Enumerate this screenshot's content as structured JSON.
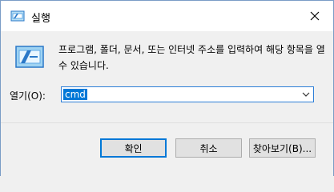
{
  "window": {
    "title": "실행",
    "description": "프로그램, 폴더, 문서, 또는 인터넷 주소를 입력하여 해당 항목을 열 수 있습니다.",
    "open_label": "열기(O):",
    "input_value": "cmd"
  },
  "buttons": {
    "ok": "확인",
    "cancel": "취소",
    "browse": "찾아보기(B)..."
  },
  "icons": {
    "title": "run-icon",
    "large": "run-large-icon",
    "close": "close-icon",
    "dropdown": "chevron-down-icon"
  },
  "colors": {
    "accent": "#0078d7",
    "selection_text": "#ffffff",
    "dialog_bg": "#f0f0f0"
  }
}
